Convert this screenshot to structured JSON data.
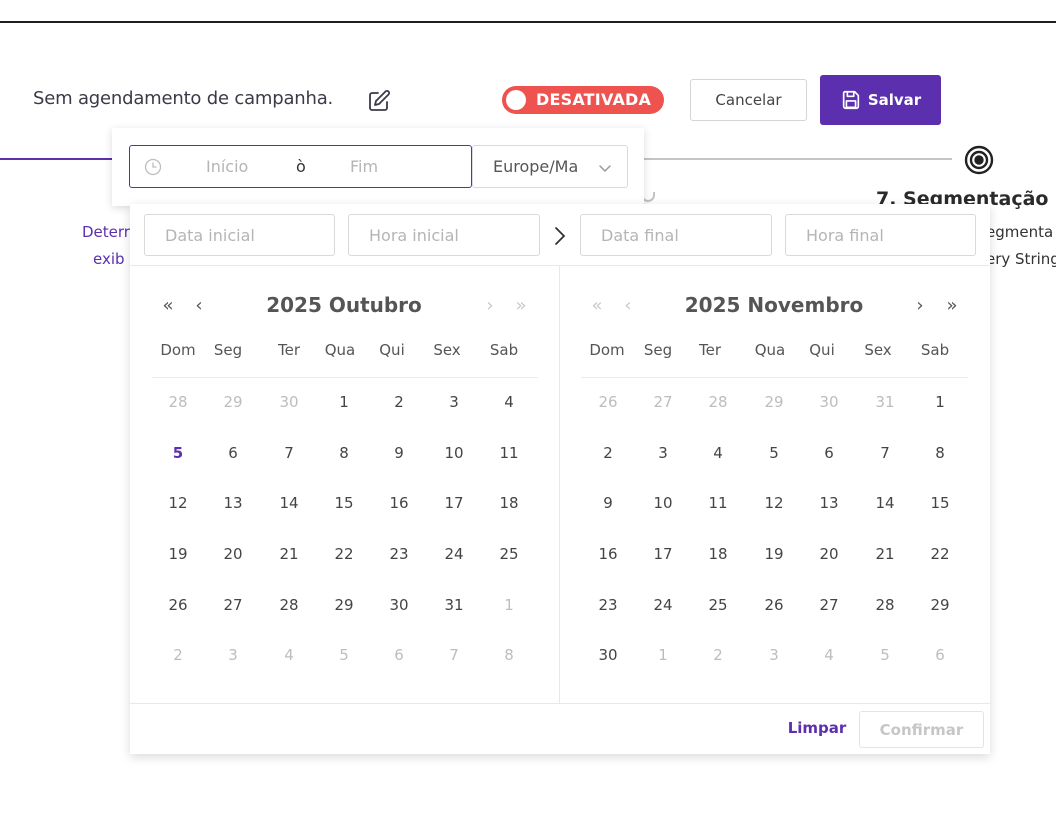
{
  "header": {
    "schedule_text": "Sem agendamento de campanha.",
    "toggle_label": "DESATIVADA",
    "cancel_label": "Cancelar",
    "save_label": "Salvar"
  },
  "steps": {
    "step7_title": "7. Segmentação",
    "step7_desc_1": "egmenta",
    "step7_desc_2": "ery String",
    "left_desc_1": "Deterr",
    "left_desc_2": "exib"
  },
  "range_picker": {
    "start_placeholder": "Início",
    "separator": "ò",
    "end_placeholder": "Fim",
    "timezone": "Europe/Ma"
  },
  "calendar": {
    "start_date_placeholder": "Data inicial",
    "start_time_placeholder": "Hora inicial",
    "end_date_placeholder": "Data final",
    "end_time_placeholder": "Hora final",
    "nav": {
      "prev_year": "«",
      "prev_month": "‹",
      "next_month": "›",
      "next_year": "»"
    },
    "weekdays": [
      "Dom",
      "Seg",
      "Ter",
      "Qua",
      "Qui",
      "Sex",
      "Sab"
    ],
    "months": [
      {
        "title": "2025 Outubro",
        "weeks": [
          [
            {
              "d": "28",
              "o": true
            },
            {
              "d": "29",
              "o": true
            },
            {
              "d": "30",
              "o": true
            },
            {
              "d": "1"
            },
            {
              "d": "2"
            },
            {
              "d": "3"
            },
            {
              "d": "4"
            }
          ],
          [
            {
              "d": "5",
              "t": true
            },
            {
              "d": "6"
            },
            {
              "d": "7"
            },
            {
              "d": "8"
            },
            {
              "d": "9"
            },
            {
              "d": "10"
            },
            {
              "d": "11"
            }
          ],
          [
            {
              "d": "12"
            },
            {
              "d": "13"
            },
            {
              "d": "14"
            },
            {
              "d": "15"
            },
            {
              "d": "16"
            },
            {
              "d": "17"
            },
            {
              "d": "18"
            }
          ],
          [
            {
              "d": "19"
            },
            {
              "d": "20"
            },
            {
              "d": "21"
            },
            {
              "d": "22"
            },
            {
              "d": "23"
            },
            {
              "d": "24"
            },
            {
              "d": "25"
            }
          ],
          [
            {
              "d": "26"
            },
            {
              "d": "27"
            },
            {
              "d": "28"
            },
            {
              "d": "29"
            },
            {
              "d": "30"
            },
            {
              "d": "31"
            },
            {
              "d": "1",
              "o": true
            }
          ],
          [
            {
              "d": "2",
              "o": true
            },
            {
              "d": "3",
              "o": true
            },
            {
              "d": "4",
              "o": true
            },
            {
              "d": "5",
              "o": true
            },
            {
              "d": "6",
              "o": true
            },
            {
              "d": "7",
              "o": true
            },
            {
              "d": "8",
              "o": true
            }
          ]
        ]
      },
      {
        "title": "2025 Novembro",
        "weeks": [
          [
            {
              "d": "26",
              "o": true
            },
            {
              "d": "27",
              "o": true
            },
            {
              "d": "28",
              "o": true
            },
            {
              "d": "29",
              "o": true
            },
            {
              "d": "30",
              "o": true
            },
            {
              "d": "31",
              "o": true
            },
            {
              "d": "1"
            }
          ],
          [
            {
              "d": "2"
            },
            {
              "d": "3"
            },
            {
              "d": "4"
            },
            {
              "d": "5"
            },
            {
              "d": "6"
            },
            {
              "d": "7"
            },
            {
              "d": "8"
            }
          ],
          [
            {
              "d": "9"
            },
            {
              "d": "10"
            },
            {
              "d": "11"
            },
            {
              "d": "12"
            },
            {
              "d": "13"
            },
            {
              "d": "14"
            },
            {
              "d": "15"
            }
          ],
          [
            {
              "d": "16"
            },
            {
              "d": "17"
            },
            {
              "d": "18"
            },
            {
              "d": "19"
            },
            {
              "d": "20"
            },
            {
              "d": "21"
            },
            {
              "d": "22"
            }
          ],
          [
            {
              "d": "23"
            },
            {
              "d": "24"
            },
            {
              "d": "25"
            },
            {
              "d": "26"
            },
            {
              "d": "27"
            },
            {
              "d": "28"
            },
            {
              "d": "29"
            }
          ],
          [
            {
              "d": "30"
            },
            {
              "d": "1",
              "o": true
            },
            {
              "d": "2",
              "o": true
            },
            {
              "d": "3",
              "o": true
            },
            {
              "d": "4",
              "o": true
            },
            {
              "d": "5",
              "o": true
            },
            {
              "d": "6",
              "o": true
            }
          ]
        ]
      }
    ],
    "clear_label": "Limpar",
    "confirm_label": "Confirmar"
  },
  "colors": {
    "accent": "#5c2fae",
    "toggle_off": "#ef5350"
  },
  "icons": [
    "edit-icon",
    "save-icon",
    "target-icon",
    "clock-icon",
    "chevron-down-icon",
    "arrow-right-icon"
  ]
}
